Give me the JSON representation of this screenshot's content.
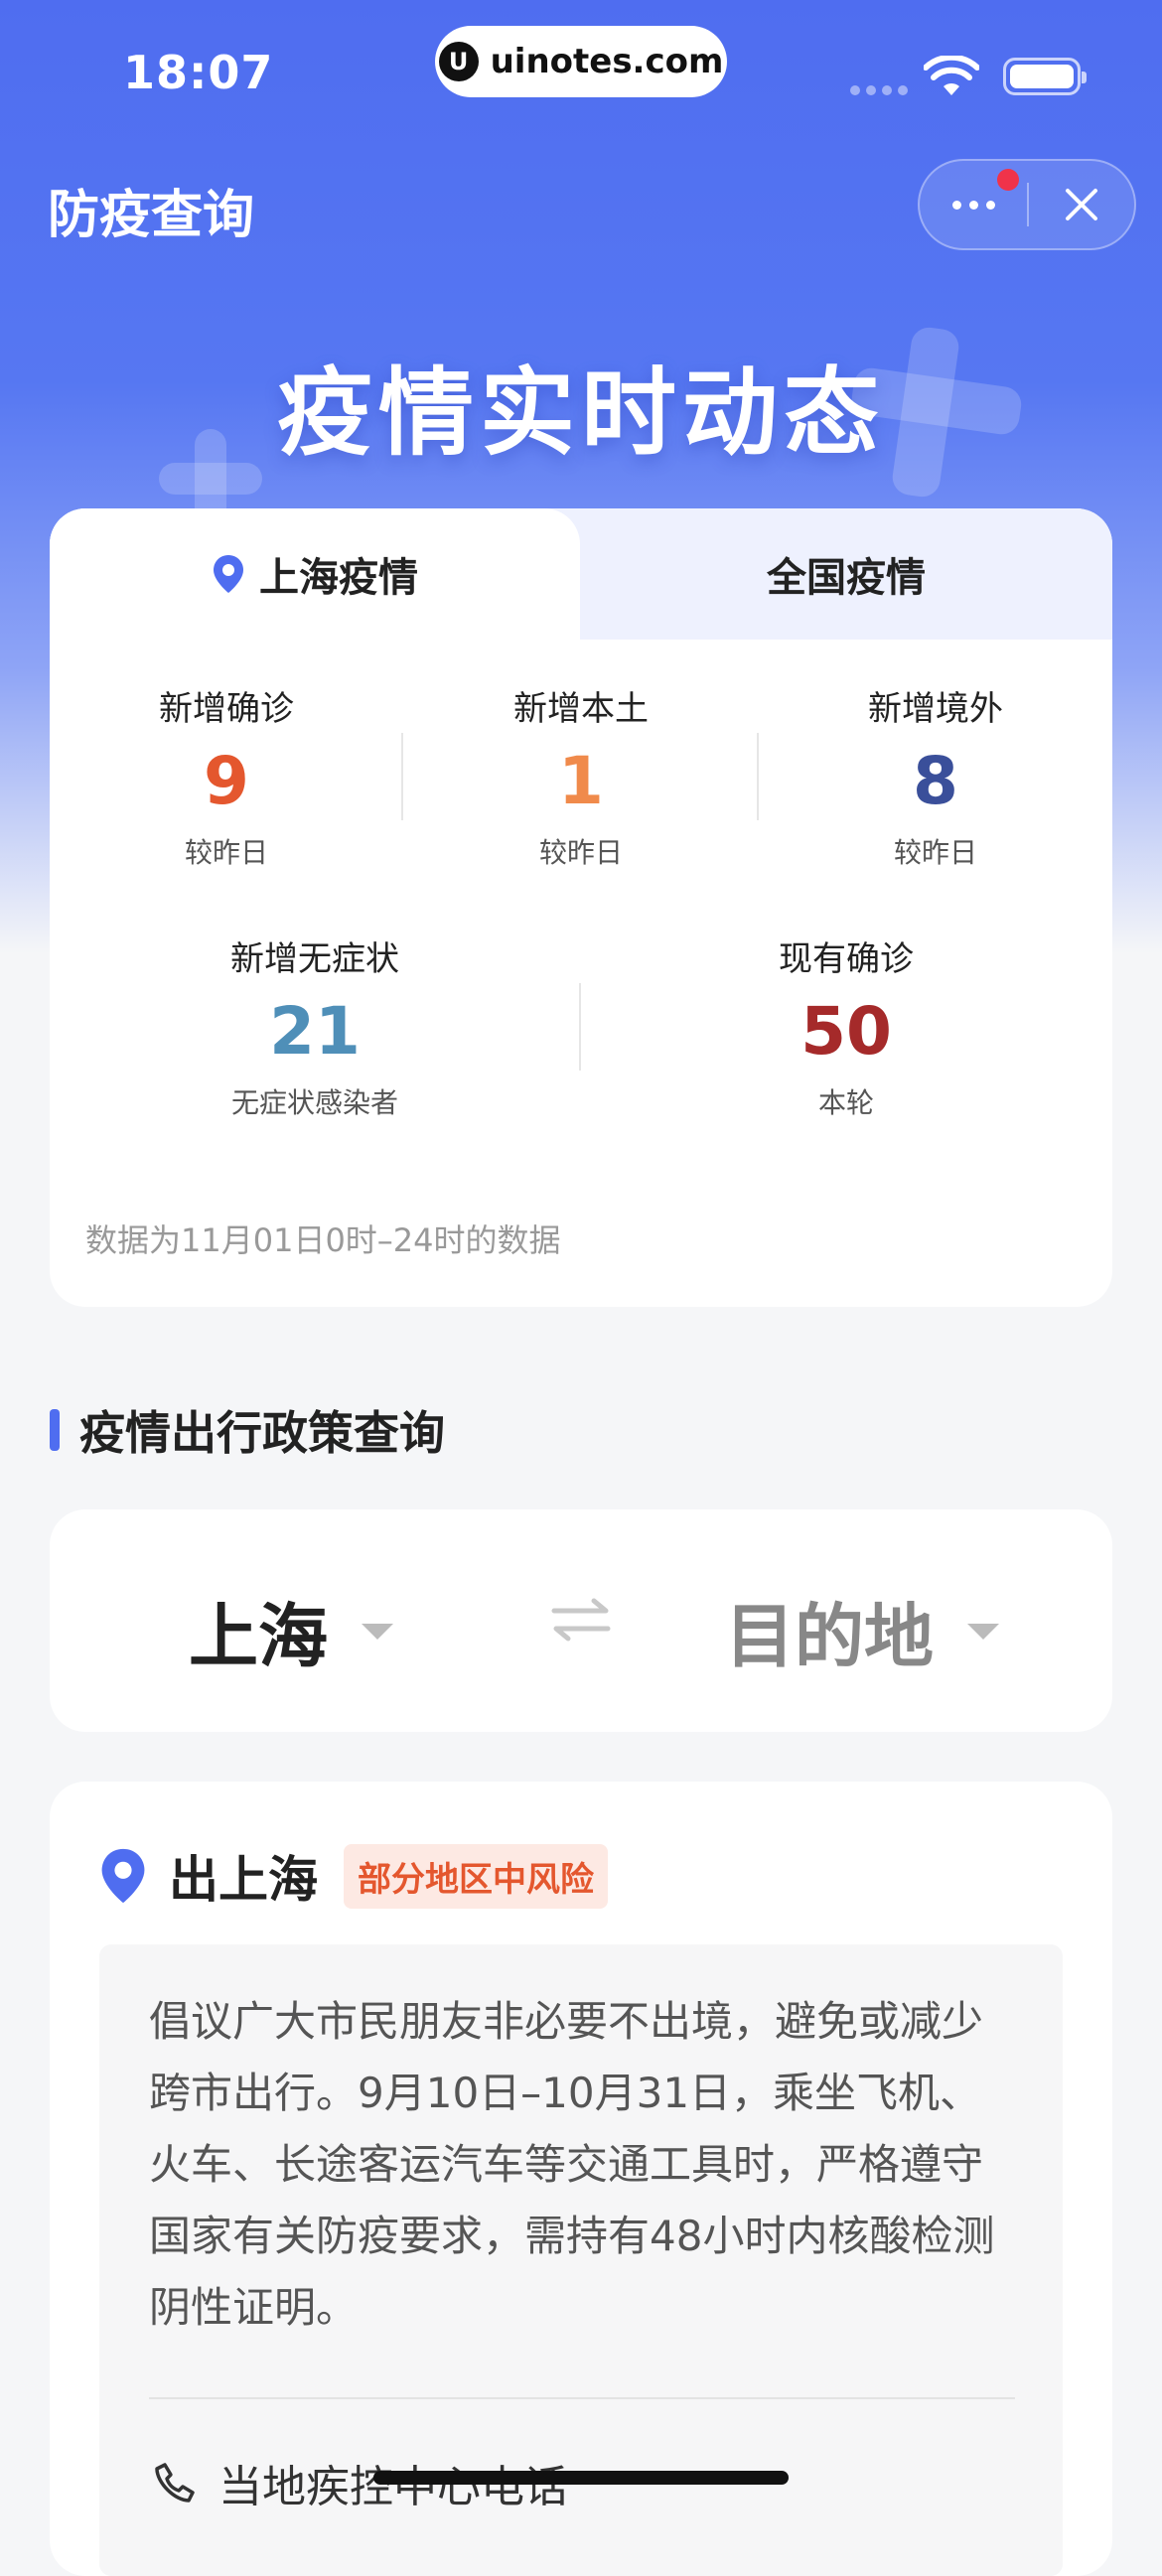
{
  "status_bar": {
    "time": "18:07",
    "url": "uinotes.com"
  },
  "nav": {
    "title": "防疫查询"
  },
  "hero": {
    "title": "疫情实时动态"
  },
  "stats": {
    "tabs": [
      "上海疫情",
      "全国疫情"
    ],
    "active_tab": "上海疫情",
    "row1": [
      {
        "label": "新增确诊",
        "value": "9",
        "sub": "较昨日",
        "color": "#e4572e"
      },
      {
        "label": "新增本土",
        "value": "1",
        "sub": "较昨日",
        "color": "#f08a4b"
      },
      {
        "label": "新增境外",
        "value": "8",
        "sub": "较昨日",
        "color": "#3a4f9a"
      }
    ],
    "row2": [
      {
        "label": "新增无症状",
        "value": "21",
        "sub": "无症状感染者",
        "color": "#4f8fb8"
      },
      {
        "label": "现有确诊",
        "value": "50",
        "sub": "本轮",
        "color": "#a52a2a"
      }
    ],
    "note": "数据为11月01日0时–24时的数据"
  },
  "travel": {
    "section_title": "疫情出行政策查询",
    "from": "上海",
    "to": "目的地"
  },
  "policy": {
    "city": "出上海",
    "risk_badge": "部分地区中风险",
    "text": "倡议广大市民朋友非必要不出境，避免或减少跨市出行。9月10日–10月31日，乘坐飞机、火车、长途客运汽车等交通工具时，严格遵守国家有关防疫要求，需持有48小时内核酸检测阴性证明。",
    "phone_label": "当地疾控中心电话"
  },
  "colors": {
    "brand": "#4f6df0",
    "risk": "#e4572e"
  },
  "icons": {
    "location": "location-pin-icon",
    "swap": "swap-arrows-icon",
    "phone": "phone-icon",
    "close": "close-icon",
    "more": "more-dots-icon"
  }
}
